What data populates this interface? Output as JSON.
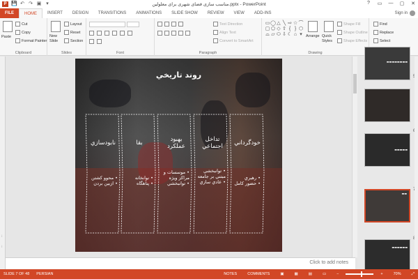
{
  "titlebar": {
    "app_icon": "P",
    "title": "مناسب سازی فضای شهری برای معلولین.pptx - PowerPoint",
    "qat_icons": [
      "save-icon",
      "undo-icon",
      "redo-icon",
      "start-slideshow-icon",
      "customize-icon"
    ],
    "qat_glyphs": [
      "💾",
      "↶",
      "↷",
      "▣",
      "▾"
    ],
    "controls": [
      "?",
      "▭",
      "—",
      "▢",
      "✕"
    ]
  },
  "tabs": {
    "file": "FILE",
    "items": [
      "HOME",
      "INSERT",
      "DESIGN",
      "TRANSITIONS",
      "ANIMATIONS",
      "SLIDE SHOW",
      "REVIEW",
      "VIEW",
      "ADD-INS"
    ],
    "active": "HOME",
    "signin": "Sign in"
  },
  "ribbon": {
    "clipboard": {
      "paste": "Paste",
      "cut": "Cut",
      "copy": "Copy",
      "format_painter": "Format Painter",
      "label": "Clipboard"
    },
    "slides": {
      "new_slide": "New Slide",
      "layout": "Layout",
      "reset": "Reset",
      "section": "Section",
      "label": "Slides"
    },
    "font": {
      "label": "Font"
    },
    "paragraph": {
      "text_direction": "Text Direction",
      "align_text": "Align Text",
      "convert": "Convert to SmartArt",
      "label": "Paragraph"
    },
    "drawing": {
      "arrange": "Arrange",
      "quick_styles": "Quick Styles",
      "shape_fill": "Shape Fill",
      "shape_outline": "Shape Outline",
      "shape_effects": "Shape Effects",
      "label": "Drawing"
    },
    "editing": {
      "find": "Find",
      "replace": "Replace",
      "select": "Select",
      "label": "Editing"
    }
  },
  "slide": {
    "title": "روند تاريخي",
    "columns": [
      {
        "head": "خودگرداني",
        "items": [
          "رهبري",
          "حضور كامل"
        ]
      },
      {
        "head": "تداخل اجتماعي",
        "items": [
          "توانبخشي مبتني بر جامعه",
          "عادي سازي"
        ]
      },
      {
        "head": "بهبود عملكرد",
        "items": [
          "موسسات و مراكز ويژه",
          "توانبخشي"
        ]
      },
      {
        "head": "بقا",
        "items": [
          "نوانخانه",
          "پناهگاه"
        ]
      },
      {
        "head": "نابودسازي",
        "items": [
          "محوو كشتن",
          "ازبين بردن"
        ]
      }
    ]
  },
  "notes": {
    "placeholder": "Click to add notes"
  },
  "thumbnails": [
    {
      "num": "4",
      "text": ""
    },
    {
      "num": "5",
      "text": ""
    },
    {
      "num": "6",
      "text": ""
    },
    {
      "num": "7",
      "text": ""
    },
    {
      "num": "8",
      "text": ""
    }
  ],
  "left_strip": [
    "⁝",
    "⁝"
  ],
  "status": {
    "slide": "SLIDE 7 OF 48",
    "language": "PERSIAN",
    "notes": "NOTES",
    "comments": "COMMENTS",
    "zoom": "70%"
  },
  "colors": {
    "accent": "#d24726",
    "ribbon_bg": "#f7f7f7",
    "status_bg": "#d24726"
  }
}
